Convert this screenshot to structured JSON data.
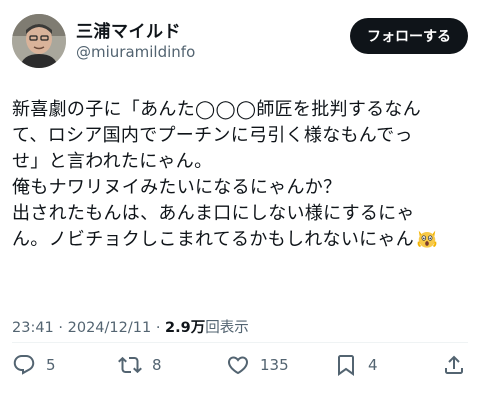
{
  "author": {
    "name": "三浦マイルド",
    "handle": "@miuramildinfo"
  },
  "follow_button": {
    "label": "フォローする"
  },
  "tweet": {
    "lines": [
      "新喜劇の子に「あんた◯◯◯師匠を批判するなん",
      "て、ロシア国内でプーチンに弓引く様なもんでっ",
      "せ」と言われたにゃん。",
      "俺もナワリヌイみたいになるにゃんか？",
      "出されたもんは、あんま口にしない様にするにゃ",
      "ん。ノビチョクしこまれてるかもしれないにゃん"
    ],
    "trailing_emoji": "screaming-cat-emoji"
  },
  "meta": {
    "time": "23:41",
    "separator": "·",
    "date": "2024/12/11",
    "views_count": "2.9万",
    "views_label": "回表示"
  },
  "actions": {
    "replies": "5",
    "retweets": "8",
    "likes": "135",
    "bookmarks": "4"
  },
  "icons": {
    "reply": "reply-icon",
    "retweet": "retweet-icon",
    "like": "heart-icon",
    "bookmark": "bookmark-icon",
    "share": "share-icon"
  }
}
